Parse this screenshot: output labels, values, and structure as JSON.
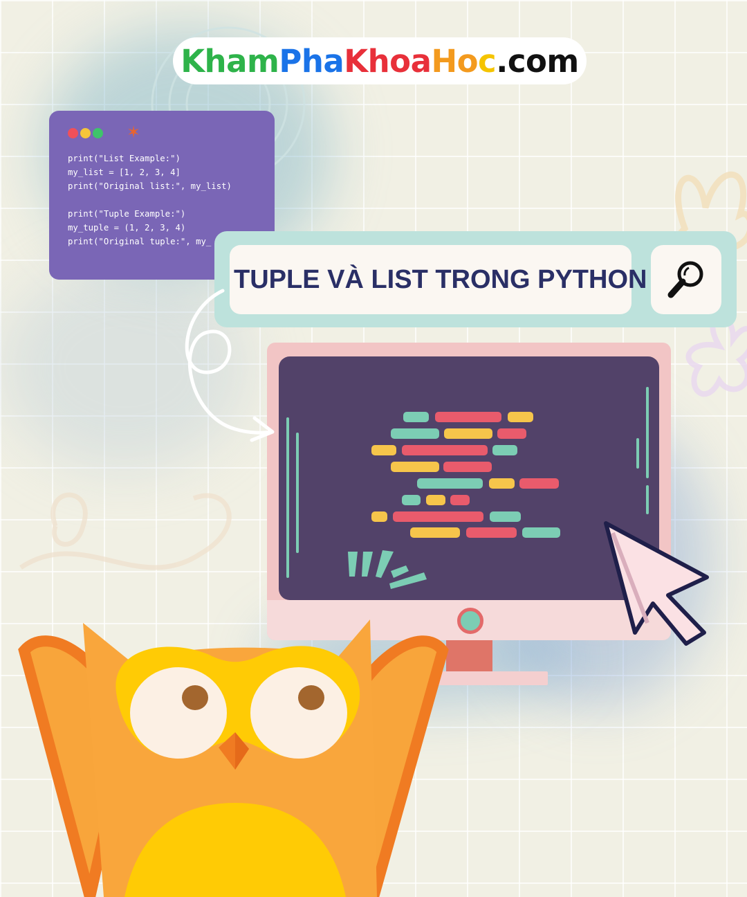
{
  "brand": {
    "parts": [
      {
        "text": "Kham",
        "color": "#2eb34a"
      },
      {
        "text": "Pha",
        "color": "#1a73e8"
      },
      {
        "text": "Khoa",
        "color": "#e8303a"
      },
      {
        "text": "Ho",
        "color": "#f39a1e"
      },
      {
        "text": "c",
        "color": "#f5c400"
      },
      {
        "text": ".com",
        "color": "#111111"
      }
    ]
  },
  "code_window": {
    "dot_colors": [
      "#f0505a",
      "#f5c53a",
      "#3ec46a"
    ],
    "lines": [
      "print(\"List Example:\")",
      "my_list = [1, 2, 3, 4]",
      "print(\"Original list:\", my_list)",
      "",
      "print(\"Tuple Example:\")",
      "my_tuple = (1, 2, 3, 4)",
      "print(\"Original tuple:\", my_"
    ]
  },
  "search": {
    "query": "TUPLE VÀ LIST TRONG PYTHON",
    "icon": "magnifier-icon"
  },
  "colors": {
    "accent_teal": "#7ccdb4",
    "accent_red": "#e95b6c",
    "accent_yellow": "#f6c54b",
    "screen": "#524269",
    "owl_orange": "#f9a63c",
    "owl_yellow": "#ffcb05"
  },
  "illustrations": [
    "monitor-icon",
    "cursor-icon",
    "owl-mascot",
    "arrow-doodle"
  ]
}
